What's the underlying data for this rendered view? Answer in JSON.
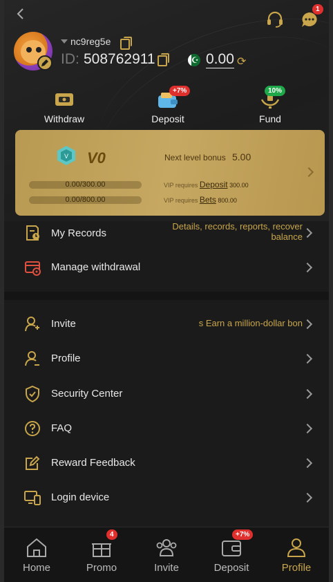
{
  "header": {
    "username": "nc9reg5e",
    "id_label": "ID:",
    "id_value": "508762911",
    "balance": "0.00",
    "chat_badge": "1"
  },
  "quick_actions": [
    {
      "label": "Withdraw",
      "badge": ""
    },
    {
      "label": "Deposit",
      "badge": "+7%"
    },
    {
      "label": "Fund",
      "badge": "10%"
    }
  ],
  "vip": {
    "level": "V0",
    "next_bonus_label": "Next level bonus",
    "next_bonus_value": "5.00",
    "deposit_progress": "0.00/300.00",
    "bets_progress": "0.00/800.00",
    "deposit_progress_fraction": 0,
    "bets_progress_fraction": 0,
    "vip_requires": "VIP requires",
    "deposit_link": "Deposit",
    "deposit_amount": "300.00",
    "bets_link": "Bets",
    "bets_amount": "800.00"
  },
  "menu_top": [
    {
      "label": "My Records",
      "hint_line1": "Details, records, reports, recover",
      "hint_line2": "balance"
    },
    {
      "label": "Manage withdrawal"
    }
  ],
  "menu": [
    {
      "label": "Invite",
      "hint": "s  Earn a million-dollar bon"
    },
    {
      "label": "Profile"
    },
    {
      "label": "Security Center"
    },
    {
      "label": "FAQ"
    },
    {
      "label": "Reward Feedback"
    },
    {
      "label": "Login device"
    }
  ],
  "tabs": [
    {
      "label": "Home",
      "badge": ""
    },
    {
      "label": "Promo",
      "badge": "4"
    },
    {
      "label": "Invite",
      "badge": ""
    },
    {
      "label": "Deposit",
      "badge": "+7%"
    },
    {
      "label": "Profile",
      "badge": ""
    }
  ],
  "colors": {
    "accent": "#c9a64b",
    "badge": "#e0302d",
    "fund_badge": "#1fa84a"
  }
}
